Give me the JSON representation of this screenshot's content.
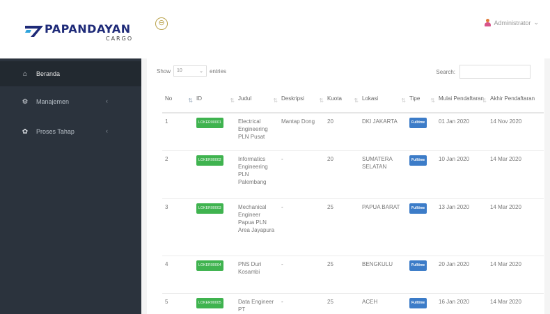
{
  "brand": {
    "name": "PAPANDAYAN",
    "sub": "CARGO"
  },
  "colors": {
    "sidebar": "#2b333d",
    "brand": "#1e2a78",
    "id_badge": "#3fb34f",
    "type_badge": "#3c7cc8"
  },
  "header": {
    "user": "Administrator",
    "user_caret": "⌄",
    "toggle_icon": "⊖"
  },
  "sidebar": {
    "items": [
      {
        "label": "Beranda",
        "icon": "home-icon",
        "glyph": "⌂",
        "caret": ""
      },
      {
        "label": "Manajemen",
        "icon": "cogs-icon",
        "glyph": "⚙",
        "caret": "‹"
      },
      {
        "label": "Proses Tahap",
        "icon": "gear-icon",
        "glyph": "✿",
        "caret": "‹"
      }
    ]
  },
  "table_controls": {
    "show_label": "Show",
    "length_value": "10",
    "entries_label": "entries",
    "search_label": "Search:"
  },
  "table": {
    "columns": [
      "No",
      "ID",
      "Judul",
      "Deskripsi",
      "Kuota",
      "Lokasi",
      "Tipe",
      "Mulai Pendaftaran",
      "Akhir Pendaftaran"
    ],
    "rows": [
      {
        "no": "1",
        "id": "LOKER00001",
        "judul": "Electrical Engineering PLN Pusat",
        "deskripsi": "Mantap Dong",
        "kuota": "20",
        "lokasi": "DKI JAKARTA",
        "tipe": "Fulltime",
        "mulai": "01 Jan 2020",
        "akhir": "14 Nov 2020"
      },
      {
        "no": "2",
        "id": "LOKER00002",
        "judul": "Informatics Engineering PLN Palembang",
        "deskripsi": "-",
        "kuota": "20",
        "lokasi": "SUMATERA SELATAN",
        "tipe": "Fulltime",
        "mulai": "10 Jan 2020",
        "akhir": "14 Mar 2020"
      },
      {
        "no": "3",
        "id": "LOKER00003",
        "judul": "Mechanical Engineer Papua PLN Area Jayapura",
        "deskripsi": "-",
        "kuota": "25",
        "lokasi": "PAPUA BARAT",
        "tipe": "Fulltime",
        "mulai": "13 Jan 2020",
        "akhir": "14 Mar 2020"
      },
      {
        "no": "4",
        "id": "LOKER00004",
        "judul": "PNS Duri Kosambi",
        "deskripsi": "-",
        "kuota": "25",
        "lokasi": "BENGKULU",
        "tipe": "Fulltime",
        "mulai": "20 Jan 2020",
        "akhir": "14 Mar 2020"
      },
      {
        "no": "5",
        "id": "LOKER00005",
        "judul": "Data Engineer PT",
        "deskripsi": "-",
        "kuota": "25",
        "lokasi": "ACEH",
        "tipe": "Fulltime",
        "mulai": "16 Jan 2020",
        "akhir": "14 Mar 2020"
      }
    ]
  }
}
